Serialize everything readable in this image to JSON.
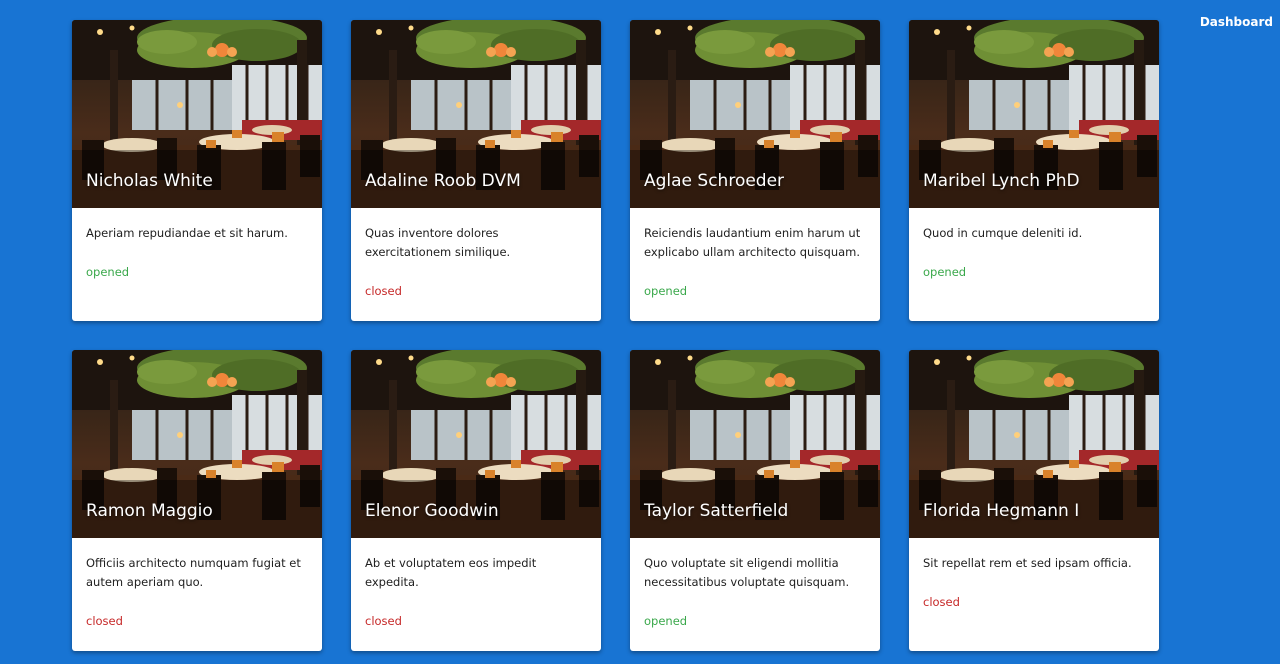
{
  "nav": {
    "dashboard_label": "Dashboard"
  },
  "colors": {
    "background": "#1874d3",
    "opened": "#3aa84b",
    "closed": "#c62828"
  },
  "cards": [
    {
      "title": "Nicholas White",
      "description": "Aperiam repudiandae et sit harum.",
      "status": "opened"
    },
    {
      "title": "Adaline Roob DVM",
      "description": "Quas inventore dolores exercitationem similique.",
      "status": "closed"
    },
    {
      "title": "Aglae Schroeder",
      "description": "Reiciendis laudantium enim harum ut explicabo ullam architecto quisquam.",
      "status": "opened"
    },
    {
      "title": "Maribel Lynch PhD",
      "description": "Quod in cumque deleniti id.",
      "status": "opened"
    },
    {
      "title": "Ramon Maggio",
      "description": "Officiis architecto numquam fugiat et autem aperiam quo.",
      "status": "closed"
    },
    {
      "title": "Elenor Goodwin",
      "description": "Ab et voluptatem eos impedit expedita.",
      "status": "closed"
    },
    {
      "title": "Taylor Satterfield",
      "description": "Quo voluptate sit eligendi mollitia necessitatibus voluptate quisquam.",
      "status": "opened"
    },
    {
      "title": "Florida Hegmann I",
      "description": "Sit repellat rem et sed ipsam officia.",
      "status": "closed"
    }
  ]
}
